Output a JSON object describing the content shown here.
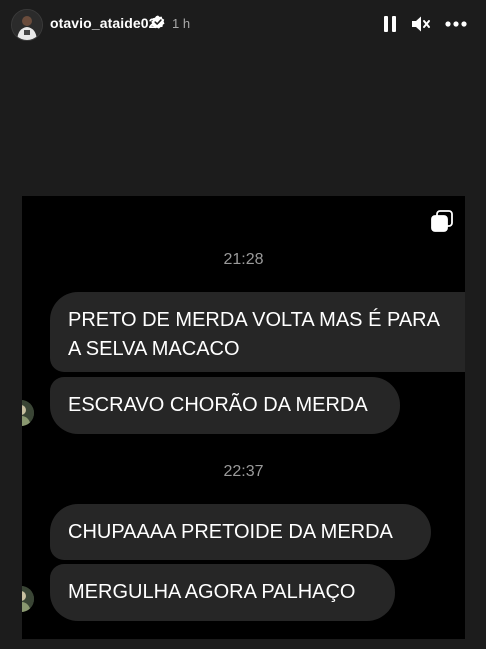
{
  "header": {
    "username": "otavio_ataide02",
    "time_ago": "1 h",
    "icons": {
      "pause": "pause-icon",
      "mute": "mute-icon",
      "more": "more-icon",
      "verified": "verified-badge-icon"
    }
  },
  "chat": {
    "copy_icon": "copy-icon",
    "groups": [
      {
        "time": "21:28",
        "messages": [
          "PRETO DE MERDA VOLTA MAS É PARA\nA SELVA MACACO",
          "ESCRAVO CHORÃO DA MERDA"
        ]
      },
      {
        "time": "22:37",
        "messages": [
          "CHUPAAAA PRETOIDE DA MERDA",
          "MERGULHA AGORA PALHAÇO"
        ]
      }
    ]
  },
  "colors": {
    "page_bg": "#1c1c1c",
    "screenshot_bg": "#000000",
    "bubble_bg": "#262626",
    "time_text": "#9a9a9a",
    "primary_text": "#ffffff",
    "secondary_text": "#a8a8a8"
  }
}
